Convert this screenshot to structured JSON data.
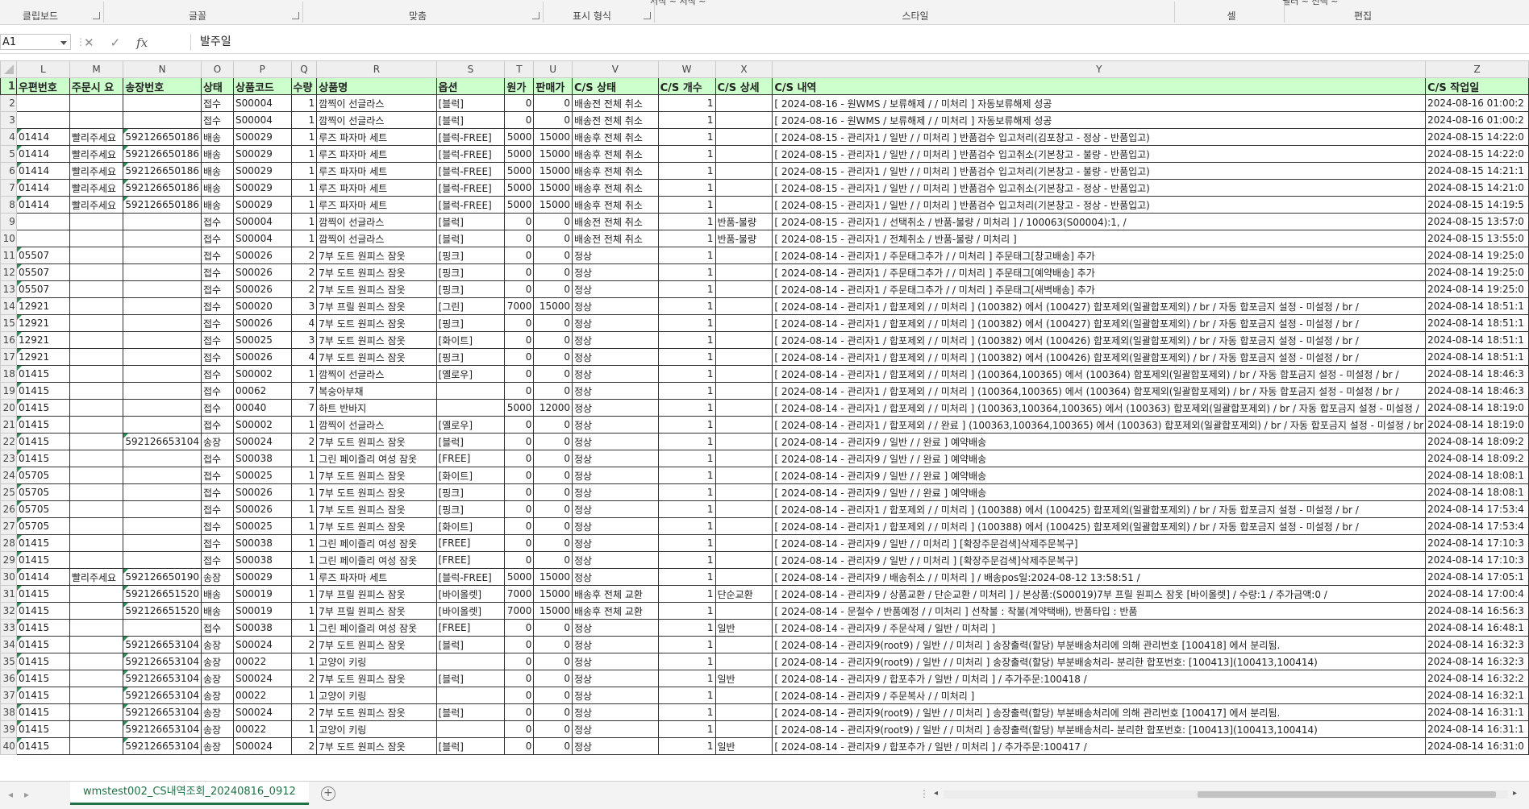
{
  "ribbon": {
    "groups": [
      "클립보드",
      "글꼴",
      "맞춤",
      "표시 형식",
      "스타일",
      "셀",
      "편집"
    ],
    "clipped_top": [
      "서식 ~ 서식 ~",
      "필터 ~ 선택 ~"
    ]
  },
  "formula_bar": {
    "cell_ref": "A1",
    "value": "발주일",
    "icons": [
      "cancel-icon",
      "enter-icon",
      "function-icon"
    ]
  },
  "columns": [
    "L",
    "M",
    "N",
    "O",
    "P",
    "Q",
    "R",
    "S",
    "T",
    "U",
    "V",
    "W",
    "X",
    "Y",
    "Z"
  ],
  "header_row": [
    "우편번호",
    "주문시 요",
    "송장번호",
    "상태",
    "상품코드",
    "수량",
    "상품명",
    "옵션",
    "원가",
    "판매가",
    "C/S 상태",
    "C/S 개수",
    "C/S 상세",
    "C/S 내역",
    "C/S 작업일"
  ],
  "rows": [
    {
      "n": "2",
      "cells": [
        "",
        "",
        "",
        "접수",
        "S00004",
        "1",
        "깜찍이 선글라스",
        "[블럭]",
        "0",
        "0",
        "배송전 전체 취소",
        "1",
        "",
        "[ 2024-08-16 - 원WMS / 보류해제 / / 미처리 ] 자동보류해제 성공",
        "2024-08-16 01:00:2"
      ]
    },
    {
      "n": "3",
      "cells": [
        "",
        "",
        "",
        "접수",
        "S00004",
        "1",
        "깜찍이 선글라스",
        "[블럭]",
        "0",
        "0",
        "배송전 전체 취소",
        "1",
        "",
        "[ 2024-08-16 - 원WMS / 보류해제 / / 미처리 ] 자동보류해제 성공",
        "2024-08-16 01:00:2"
      ]
    },
    {
      "n": "4",
      "cells": [
        "01414",
        "빨리주세요",
        "592126650186",
        "배송",
        "S00029",
        "1",
        "루즈 파자마 세트",
        "[블럭-FREE]",
        "5000",
        "15000",
        "배송후 전체 취소",
        "1",
        "",
        "[ 2024-08-15 - 관리자1 / 일반 / / 미처리 ] 반품검수 입고처리(김포창고 - 정상 - 반품입고)",
        "2024-08-15 14:22:0"
      ]
    },
    {
      "n": "5",
      "cells": [
        "01414",
        "빨리주세요",
        "592126650186",
        "배송",
        "S00029",
        "1",
        "루즈 파자마 세트",
        "[블럭-FREE]",
        "5000",
        "15000",
        "배송후 전체 취소",
        "1",
        "",
        "[ 2024-08-15 - 관리자1 / 일반 / / 미처리 ] 반품검수 입고취소(기본창고 - 불량 - 반품입고)",
        "2024-08-15 14:22:0"
      ]
    },
    {
      "n": "6",
      "cells": [
        "01414",
        "빨리주세요",
        "592126650186",
        "배송",
        "S00029",
        "1",
        "루즈 파자마 세트",
        "[블럭-FREE]",
        "5000",
        "15000",
        "배송후 전체 취소",
        "1",
        "",
        "[ 2024-08-15 - 관리자1 / 일반 / / 미처리 ] 반품검수 입고처리(기본창고 - 불량 - 반품입고)",
        "2024-08-15 14:21:1"
      ]
    },
    {
      "n": "7",
      "cells": [
        "01414",
        "빨리주세요",
        "592126650186",
        "배송",
        "S00029",
        "1",
        "루즈 파자마 세트",
        "[블럭-FREE]",
        "5000",
        "15000",
        "배송후 전체 취소",
        "1",
        "",
        "[ 2024-08-15 - 관리자1 / 일반 / / 미처리 ] 반품검수 입고취소(기본창고 - 정상 - 반품입고)",
        "2024-08-15 14:21:0"
      ]
    },
    {
      "n": "8",
      "cells": [
        "01414",
        "빨리주세요",
        "592126650186",
        "배송",
        "S00029",
        "1",
        "루즈 파자마 세트",
        "[블럭-FREE]",
        "5000",
        "15000",
        "배송후 전체 취소",
        "1",
        "",
        "[ 2024-08-15 - 관리자1 / 일반 / / 미처리 ] 반품검수 입고처리(기본창고 - 정상 - 반품입고)",
        "2024-08-15 14:19:5"
      ]
    },
    {
      "n": "9",
      "cells": [
        "",
        "",
        "",
        "접수",
        "S00004",
        "1",
        "깜찍이 선글라스",
        "[블럭]",
        "0",
        "0",
        "배송전 전체 취소",
        "1",
        "반품-불량",
        "[ 2024-08-15 - 관리자1 / 선택취소 / 반품-불량 / 미처리 ] / 100063(S00004):1, /",
        "2024-08-15 13:57:0"
      ]
    },
    {
      "n": "10",
      "cells": [
        "",
        "",
        "",
        "접수",
        "S00004",
        "1",
        "깜찍이 선글라스",
        "[블럭]",
        "0",
        "0",
        "배송전 전체 취소",
        "1",
        "반품-불량",
        "[ 2024-08-15 - 관리자1 / 전체취소 / 반품-불량 / 미처리 ]",
        "2024-08-15 13:55:0"
      ]
    },
    {
      "n": "11",
      "cells": [
        "05507",
        "",
        "",
        "접수",
        "S00026",
        "2",
        "7부 도트 원피스 잠옷",
        "[핑크]",
        "0",
        "0",
        "정상",
        "1",
        "",
        "[ 2024-08-14 - 관리자1 / 주문태그추가 / / 미처리 ] 주문태그[창고배송] 추가",
        "2024-08-14 19:25:0"
      ]
    },
    {
      "n": "12",
      "cells": [
        "05507",
        "",
        "",
        "접수",
        "S00026",
        "2",
        "7부 도트 원피스 잠옷",
        "[핑크]",
        "0",
        "0",
        "정상",
        "1",
        "",
        "[ 2024-08-14 - 관리자1 / 주문태그추가 / / 미처리 ] 주문태그[예약배송] 추가",
        "2024-08-14 19:25:0"
      ]
    },
    {
      "n": "13",
      "cells": [
        "05507",
        "",
        "",
        "접수",
        "S00026",
        "2",
        "7부 도트 원피스 잠옷",
        "[핑크]",
        "0",
        "0",
        "정상",
        "1",
        "",
        "[ 2024-08-14 - 관리자1 / 주문태그추가 / / 미처리 ] 주문태그[새벽배송] 추가",
        "2024-08-14 19:25:0"
      ]
    },
    {
      "n": "14",
      "cells": [
        "12921",
        "",
        "",
        "접수",
        "S00020",
        "3",
        "7부 프릴 원피스 잠옷",
        "[그린]",
        "7000",
        "15000",
        "정상",
        "1",
        "",
        "[ 2024-08-14 - 관리자1 / 합포제외 / / 미처리 ] (100382) 에서 (100427) 합포제외(일괄합포제외) / br / 자동 합포금지 설정 - 미설정 / br /",
        "2024-08-14 18:51:1"
      ]
    },
    {
      "n": "15",
      "cells": [
        "12921",
        "",
        "",
        "접수",
        "S00026",
        "4",
        "7부 도트 원피스 잠옷",
        "[핑크]",
        "0",
        "0",
        "정상",
        "1",
        "",
        "[ 2024-08-14 - 관리자1 / 합포제외 / / 미처리 ] (100382) 에서 (100427) 합포제외(일괄합포제외) / br / 자동 합포금지 설정 - 미설정 / br /",
        "2024-08-14 18:51:1"
      ]
    },
    {
      "n": "16",
      "cells": [
        "12921",
        "",
        "",
        "접수",
        "S00025",
        "3",
        "7부 도트 원피스 잠옷",
        "[화이트]",
        "0",
        "0",
        "정상",
        "1",
        "",
        "[ 2024-08-14 - 관리자1 / 합포제외 / / 미처리 ] (100382) 에서 (100426) 합포제외(일괄합포제외) / br / 자동 합포금지 설정 - 미설정 / br /",
        "2024-08-14 18:51:1"
      ]
    },
    {
      "n": "17",
      "cells": [
        "12921",
        "",
        "",
        "접수",
        "S00026",
        "4",
        "7부 도트 원피스 잠옷",
        "[핑크]",
        "0",
        "0",
        "정상",
        "1",
        "",
        "[ 2024-08-14 - 관리자1 / 합포제외 / / 미처리 ] (100382) 에서 (100426) 합포제외(일괄합포제외) / br / 자동 합포금지 설정 - 미설정 / br /",
        "2024-08-14 18:51:1"
      ]
    },
    {
      "n": "18",
      "cells": [
        "01415",
        "",
        "",
        "접수",
        "S00002",
        "1",
        "깜찍이 선글라스",
        "[옐로우]",
        "0",
        "0",
        "정상",
        "1",
        "",
        "[ 2024-08-14 - 관리자1 / 합포제외 / / 미처리 ] (100364,100365) 에서 (100364) 합포제외(일괄합포제외) / br / 자동 합포금지 설정 - 미설정 / br /",
        "2024-08-14 18:46:3"
      ]
    },
    {
      "n": "19",
      "cells": [
        "01415",
        "",
        "",
        "접수",
        "00062",
        "7",
        "복숭아부채",
        "",
        "0",
        "0",
        "정상",
        "1",
        "",
        "[ 2024-08-14 - 관리자1 / 합포제외 / / 미처리 ] (100364,100365) 에서 (100364) 합포제외(일괄합포제외) / br / 자동 합포금지 설정 - 미설정 / br /",
        "2024-08-14 18:46:3"
      ]
    },
    {
      "n": "20",
      "cells": [
        "01415",
        "",
        "",
        "접수",
        "00040",
        "7",
        "하트 반바지",
        "",
        "5000",
        "12000",
        "정상",
        "1",
        "",
        "[ 2024-08-14 - 관리자1 / 합포제외 / / 미처리 ] (100363,100364,100365) 에서 (100363) 합포제외(일괄합포제외) / br / 자동 합포금지 설정 - 미설정 /",
        "2024-08-14 18:19:0"
      ]
    },
    {
      "n": "21",
      "cells": [
        "01415",
        "",
        "",
        "접수",
        "S00002",
        "1",
        "깜찍이 선글라스",
        "[옐로우]",
        "0",
        "0",
        "정상",
        "1",
        "",
        "[ 2024-08-14 - 관리자1 / 합포제외 / / 완료 ] (100363,100364,100365) 에서 (100363) 합포제외(일괄합포제외) / br / 자동 합포금지 설정 - 미설정 / br",
        "2024-08-14 18:19:0"
      ]
    },
    {
      "n": "22",
      "cells": [
        "01415",
        "",
        "592126653104",
        "송장",
        "S00024",
        "2",
        "7부 도트 원피스 잠옷",
        "[블럭]",
        "0",
        "0",
        "정상",
        "1",
        "",
        "[ 2024-08-14 - 관리자9 / 일반 / / 완료 ] 예약배송",
        "2024-08-14 18:09:2"
      ]
    },
    {
      "n": "23",
      "cells": [
        "01415",
        "",
        "",
        "접수",
        "S00038",
        "1",
        "그린 페이즐리 여성 잠옷",
        "[FREE]",
        "0",
        "0",
        "정상",
        "1",
        "",
        "[ 2024-08-14 - 관리자9 / 일반 / / 완료 ] 예약배송",
        "2024-08-14 18:09:2"
      ]
    },
    {
      "n": "24",
      "cells": [
        "05705",
        "",
        "",
        "접수",
        "S00025",
        "1",
        "7부 도트 원피스 잠옷",
        "[화이트]",
        "0",
        "0",
        "정상",
        "1",
        "",
        "[ 2024-08-14 - 관리자9 / 일반 / / 완료 ] 예약배송",
        "2024-08-14 18:08:1"
      ]
    },
    {
      "n": "25",
      "cells": [
        "05705",
        "",
        "",
        "접수",
        "S00026",
        "1",
        "7부 도트 원피스 잠옷",
        "[핑크]",
        "0",
        "0",
        "정상",
        "1",
        "",
        "[ 2024-08-14 - 관리자9 / 일반 / / 완료 ] 예약배송",
        "2024-08-14 18:08:1"
      ]
    },
    {
      "n": "26",
      "cells": [
        "05705",
        "",
        "",
        "접수",
        "S00026",
        "1",
        "7부 도트 원피스 잠옷",
        "[핑크]",
        "0",
        "0",
        "정상",
        "1",
        "",
        "[ 2024-08-14 - 관리자1 / 합포제외 / / 미처리 ] (100388) 에서 (100425) 합포제외(일괄합포제외) / br / 자동 합포금지 설정 - 미설정 / br /",
        "2024-08-14 17:53:4"
      ]
    },
    {
      "n": "27",
      "cells": [
        "05705",
        "",
        "",
        "접수",
        "S00025",
        "1",
        "7부 도트 원피스 잠옷",
        "[화이트]",
        "0",
        "0",
        "정상",
        "1",
        "",
        "[ 2024-08-14 - 관리자1 / 합포제외 / / 미처리 ] (100388) 에서 (100425) 합포제외(일괄합포제외) / br / 자동 합포금지 설정 - 미설정 / br /",
        "2024-08-14 17:53:4"
      ]
    },
    {
      "n": "28",
      "cells": [
        "01415",
        "",
        "",
        "접수",
        "S00038",
        "1",
        "그린 페이즐리 여성 잠옷",
        "[FREE]",
        "0",
        "0",
        "정상",
        "1",
        "",
        "[ 2024-08-14 - 관리자9 / 일반 / / 미처리 ] [확장주문검색]삭제주문복구]",
        "2024-08-14 17:10:3"
      ]
    },
    {
      "n": "29",
      "cells": [
        "01415",
        "",
        "",
        "접수",
        "S00038",
        "1",
        "그린 페이즐리 여성 잠옷",
        "[FREE]",
        "0",
        "0",
        "정상",
        "1",
        "",
        "[ 2024-08-14 - 관리자9 / 일반 / / 미처리 ] [확장주문검색]삭제주문복구]",
        "2024-08-14 17:10:3"
      ]
    },
    {
      "n": "30",
      "cells": [
        "01414",
        "빨리주세요",
        "592126650190",
        "송장",
        "S00029",
        "1",
        "루즈 파자마 세트",
        "[블럭-FREE]",
        "5000",
        "15000",
        "정상",
        "1",
        "",
        "[ 2024-08-14 - 관리자9 / 배송취소 / / 미처리 ] / 배송pos일:2024-08-12 13:58:51 /",
        "2024-08-14 17:05:1"
      ]
    },
    {
      "n": "31",
      "cells": [
        "01415",
        "",
        "592126651520",
        "배송",
        "S00019",
        "1",
        "7부 프릴 원피스 잠옷",
        "[바이올렛]",
        "7000",
        "15000",
        "배송후 전체 교환",
        "1",
        "단순교환",
        "[ 2024-08-14 - 관리자9 / 상품교환 / 단순교환 / 미처리 ] / 본상품:(S00019)7부 프릴 원피스 잠옷 [바이올렛] / 수량:1 / 추가금액:0 /",
        "2024-08-14 17:00:4"
      ]
    },
    {
      "n": "32",
      "cells": [
        "01415",
        "",
        "592126651520",
        "배송",
        "S00019",
        "1",
        "7부 프릴 원피스 잠옷",
        "[바이올렛]",
        "7000",
        "15000",
        "배송후 전체 교환",
        "1",
        "",
        "[ 2024-08-14 - 문철수 / 반품예정 / / 미처리 ] 선착불 : 착불(계약택배), 반품타입 : 반품",
        "2024-08-14 16:56:3"
      ]
    },
    {
      "n": "33",
      "cells": [
        "01415",
        "",
        "",
        "접수",
        "S00038",
        "1",
        "그린 페이즐리 여성 잠옷",
        "[FREE]",
        "0",
        "0",
        "정상",
        "1",
        "일반",
        "[ 2024-08-14 - 관리자9 / 주문삭제 / 일반 / 미처리 ]",
        "2024-08-14 16:48:1"
      ]
    },
    {
      "n": "34",
      "cells": [
        "01415",
        "",
        "592126653104",
        "송장",
        "S00024",
        "2",
        "7부 도트 원피스 잠옷",
        "[블럭]",
        "0",
        "0",
        "정상",
        "1",
        "",
        "[ 2024-08-14 - 관리자9(root9) / 일반 / / 미처리 ] 송장출력(할당) 부분배송처리에 의해 관리번호 [100418] 에서 분리됨.",
        "2024-08-14 16:32:3"
      ]
    },
    {
      "n": "35",
      "cells": [
        "01415",
        "",
        "592126653104",
        "송장",
        "00022",
        "1",
        "고양이 키링",
        "",
        "0",
        "0",
        "정상",
        "1",
        "",
        "[ 2024-08-14 - 관리자9(root9) / 일반 / / 미처리 ] 송장출력(할당) 부분배송처리- 분리한 합포번호: [100413](100413,100414)",
        "2024-08-14 16:32:3"
      ]
    },
    {
      "n": "36",
      "cells": [
        "01415",
        "",
        "592126653104",
        "송장",
        "S00024",
        "2",
        "7부 도트 원피스 잠옷",
        "[블럭]",
        "0",
        "0",
        "정상",
        "1",
        "일반",
        "[ 2024-08-14 - 관리자9 / 합포추가 / 일반 / 미처리 ] / 추가주문:100418 /",
        "2024-08-14 16:32:2"
      ]
    },
    {
      "n": "37",
      "cells": [
        "01415",
        "",
        "592126653104",
        "송장",
        "00022",
        "1",
        "고양이 키링",
        "",
        "0",
        "0",
        "정상",
        "1",
        "",
        "[ 2024-08-14 - 관리자9 / 주문복사 / / 미처리 ]",
        "2024-08-14 16:32:1"
      ]
    },
    {
      "n": "38",
      "cells": [
        "01415",
        "",
        "592126653104",
        "송장",
        "S00024",
        "2",
        "7부 도트 원피스 잠옷",
        "[블럭]",
        "0",
        "0",
        "정상",
        "1",
        "",
        "[ 2024-08-14 - 관리자9(root9) / 일반 / / 미처리 ] 송장출력(할당) 부분배송처리에 의해 관리번호 [100417] 에서 분리됨.",
        "2024-08-14 16:31:1"
      ]
    },
    {
      "n": "39",
      "cells": [
        "01415",
        "",
        "592126653104",
        "송장",
        "00022",
        "1",
        "고양이 키링",
        "",
        "0",
        "0",
        "정상",
        "1",
        "",
        "[ 2024-08-14 - 관리자9(root9) / 일반 / / 미처리 ] 송장출력(할당) 부분배송처리- 분리한 합포번호: [100413](100413,100414)",
        "2024-08-14 16:31:1"
      ]
    },
    {
      "n": "40",
      "cells": [
        "01415",
        "",
        "592126653104",
        "송장",
        "S00024",
        "2",
        "7부 도트 원피스 잠옷",
        "[블럭]",
        "0",
        "0",
        "정상",
        "1",
        "일반",
        "[ 2024-08-14 - 관리자9 / 합포추가 / 일반 / 미처리 ] / 추가주문:100417 /",
        "2024-08-14 16:31:0"
      ]
    }
  ],
  "row_header_first": "1",
  "sheet_tab": "wmstest002_CS내역조회_20240816_0912",
  "colors": {
    "header_fill": "#ccffcc",
    "tab_accent": "#1e7145",
    "error_triangle": "#2e8b57"
  }
}
